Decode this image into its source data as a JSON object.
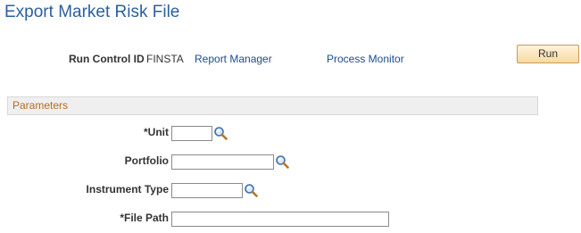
{
  "page": {
    "title": "Export Market Risk File"
  },
  "run_control": {
    "label": "Run Control ID",
    "value": "FINSTA",
    "report_manager_link": "Report Manager",
    "process_monitor_link": "Process Monitor",
    "run_button": "Run"
  },
  "parameters": {
    "title": "Parameters",
    "fields": {
      "unit": {
        "label": "*Unit",
        "value": "",
        "lookup_icon": "magnifier-icon"
      },
      "portfolio": {
        "label": "Portfolio",
        "value": "",
        "lookup_icon": "magnifier-icon"
      },
      "instrument_type": {
        "label": "Instrument Type",
        "value": "",
        "lookup_icon": "magnifier-icon"
      },
      "file_path": {
        "label": "*File Path",
        "value": ""
      }
    }
  },
  "colors": {
    "title": "#2b5f9e",
    "link": "#1c4c8c",
    "group_title": "#b56b23",
    "group_bg": "#efefef",
    "button_bg": "#f8d9a2"
  }
}
